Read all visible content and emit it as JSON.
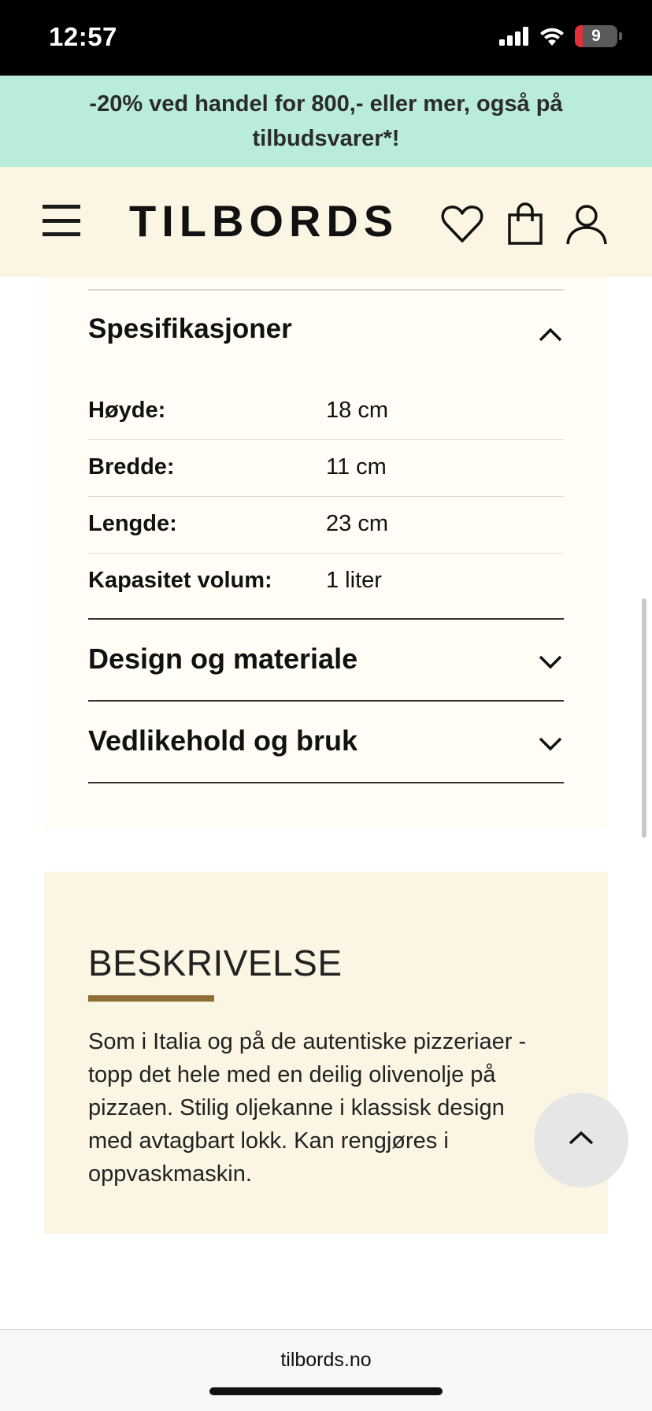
{
  "status_bar": {
    "time": "12:57",
    "battery_level": "9",
    "icons": [
      "signal-icon",
      "wifi-icon",
      "battery-icon"
    ]
  },
  "promo": {
    "text": "-20% ved handel for 800,- eller mer, også på tilbudsvarer*!",
    "background": "#b9ecd9"
  },
  "header": {
    "logo": "TILBORDS",
    "icons": [
      "menu-icon",
      "heart-icon",
      "bag-icon",
      "user-icon"
    ],
    "background": "#fbf5e3"
  },
  "specs": {
    "title": "Spesifikasjoner",
    "expanded": true,
    "rows": [
      {
        "label": "Høyde:",
        "value": "18 cm"
      },
      {
        "label": "Bredde:",
        "value": "11 cm"
      },
      {
        "label": "Lengde:",
        "value": "23 cm"
      },
      {
        "label": "Kapasitet volum:",
        "value": "1 liter"
      }
    ]
  },
  "sections": [
    {
      "title": "Design og materiale",
      "expanded": false
    },
    {
      "title": "Vedlikehold og bruk",
      "expanded": false
    }
  ],
  "description": {
    "title": "BESKRIVELSE",
    "text": "Som i Italia og på de autentiske pizzeriaer - topp det hele med en deilig olivenolje på pizzaen. Stilig oljekanne i klassisk design med avtagbart lokk. Kan rengjøres i oppvaskmaskin.",
    "accent_color": "#8e6e35"
  },
  "browser": {
    "url": "tilbords.no"
  }
}
